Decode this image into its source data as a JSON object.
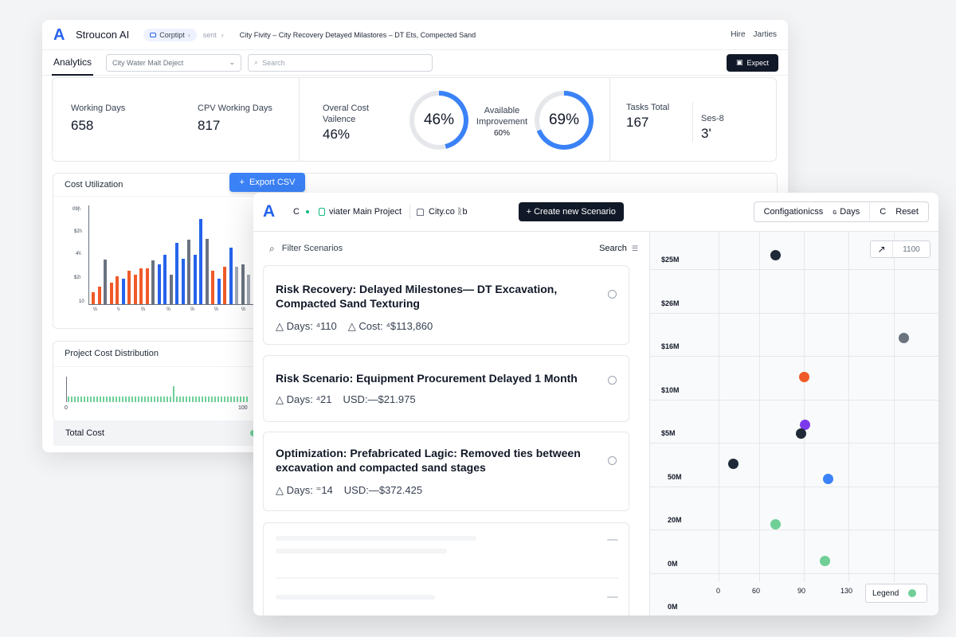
{
  "back": {
    "app_name": "Stroucon AI",
    "chip_label": "Corptipt",
    "sent_label": "sent",
    "breadcrumb": "City Fivity – City Recovery Detayed Milastores – DT Ets, Compected Sand",
    "user_links": [
      "Hire",
      "Jarties"
    ],
    "tab_analytics": "Analytics",
    "project_select": "City Water Malt Deject",
    "search_placeholder": "Search",
    "export_label": "Expect",
    "stats": {
      "working_days_label": "Working Days",
      "working_days_value": "658",
      "cpv_label": "CPV Working Days",
      "cpv_value": "817",
      "overall_label": "Overal Cost Vailence",
      "overall_value": "46%",
      "donut1_value": "46%",
      "donut1_fraction": 0.46,
      "available_label": "Available Improvement",
      "available_value": "60%",
      "donut2_value": "69%",
      "donut2_fraction": 0.69,
      "tasks_label": "Tasks Total",
      "tasks_value": "167",
      "ses_label": "Ses-8",
      "ses_value": "3'"
    },
    "cost_util_title": "Cost Utilization",
    "export_csv_label": "Export CSV",
    "cost_util_y_ticks": [
      "09|\\",
      "$2\\\\",
      "4\\\\",
      "$2\\",
      "10"
    ],
    "cost_util_x_ticks": [
      "\\\\\\",
      "\\\\",
      "\\\\\\",
      "\\\\\\",
      "\\\\\\",
      "\\\\\\",
      "\\\\\\",
      "\\\\\\"
    ],
    "dist_title": "Project Cost Distribution",
    "dist_x_ticks": [
      "0",
      "100"
    ],
    "total_cost_label": "Total Cost"
  },
  "chart_data": [
    {
      "type": "bar",
      "title": "Cost Utilization",
      "colors": {
        "orange": "#f05a28",
        "blue": "#2563eb",
        "gray": "#6b7280",
        "light": "#a3aab6"
      },
      "bars": [
        [
          "orange",
          0.12
        ],
        [
          "orange",
          0.18
        ],
        [
          "gray",
          0.45
        ],
        [
          "orange",
          0.22
        ],
        [
          "orange",
          0.28
        ],
        [
          "blue",
          0.26
        ],
        [
          "orange",
          0.34
        ],
        [
          "orange",
          0.3
        ],
        [
          "orange",
          0.36
        ],
        [
          "orange",
          0.36
        ],
        [
          "gray",
          0.44
        ],
        [
          "blue",
          0.4
        ],
        [
          "blue",
          0.5
        ],
        [
          "gray",
          0.3
        ],
        [
          "blue",
          0.62
        ],
        [
          "blue",
          0.46
        ],
        [
          "gray",
          0.65
        ],
        [
          "blue",
          0.5
        ],
        [
          "blue",
          0.86
        ],
        [
          "gray",
          0.66
        ],
        [
          "orange",
          0.34
        ],
        [
          "blue",
          0.26
        ],
        [
          "orange",
          0.38
        ],
        [
          "blue",
          0.57
        ],
        [
          "light",
          0.38
        ],
        [
          "gray",
          0.4
        ],
        [
          "light",
          0.3
        ],
        [
          "gray",
          0.38
        ]
      ]
    },
    {
      "type": "scatter",
      "title": "",
      "x_ticks": [
        "0",
        "60",
        "90",
        "130"
      ],
      "y_ticks": [
        "$25M",
        "$26M",
        "$16M",
        "$10M",
        "$5M",
        "50M",
        "20M",
        "0M",
        "0M"
      ],
      "points": [
        {
          "x": 60,
          "y_row": 0.15,
          "color": "#1f2937"
        },
        {
          "x": 175,
          "y_row": 2.05,
          "color": "#6b7280"
        },
        {
          "x": 90,
          "y_row": 2.95,
          "color": "#f05a28"
        },
        {
          "x": 91,
          "y_row": 4.05,
          "color": "#7c3aed"
        },
        {
          "x": 87,
          "y_row": 4.25,
          "color": "#1f2937"
        },
        {
          "x": 15,
          "y_row": 4.95,
          "color": "#1f2937"
        },
        {
          "x": 115,
          "y_row": 5.3,
          "color": "#3b82f6"
        },
        {
          "x": 60,
          "y_row": 6.35,
          "color": "#6fcf97"
        },
        {
          "x": 112,
          "y_row": 7.2,
          "color": "#6fcf97"
        }
      ]
    }
  ],
  "front": {
    "back_glyph": "C",
    "project_name": "viater Main Project",
    "city_name": "City.co ᚱb",
    "create_label": "+ Create new Scenario",
    "seg_config": "Configationicss",
    "seg_days": "Days",
    "seg_days_glyph": "ɢ",
    "seg_reset": "Reset",
    "seg_reset_glyph": "C",
    "filter_label": "Filter Scenarios",
    "search_label": "Search",
    "cards": [
      {
        "title": "Risk Recovery: Delayed Milestones— DT Excavation, Compacted Sand Texturing",
        "days": "Days: ⁴110",
        "cost": "Cost: ⁴$113,860"
      },
      {
        "title": "Risk Scenario: Equipment Procurement Delayed 1 Month",
        "days": "Days: ⁴21",
        "cost": "USD:—$21.975"
      },
      {
        "title": "Optimization: Prefabricated Lagic: Removed ties between excavation and compacted sand stages",
        "days": "Days: ⁼14",
        "cost": "USD:—$372.425"
      }
    ],
    "zoom_value": "1100",
    "legend_label": "Legend"
  }
}
